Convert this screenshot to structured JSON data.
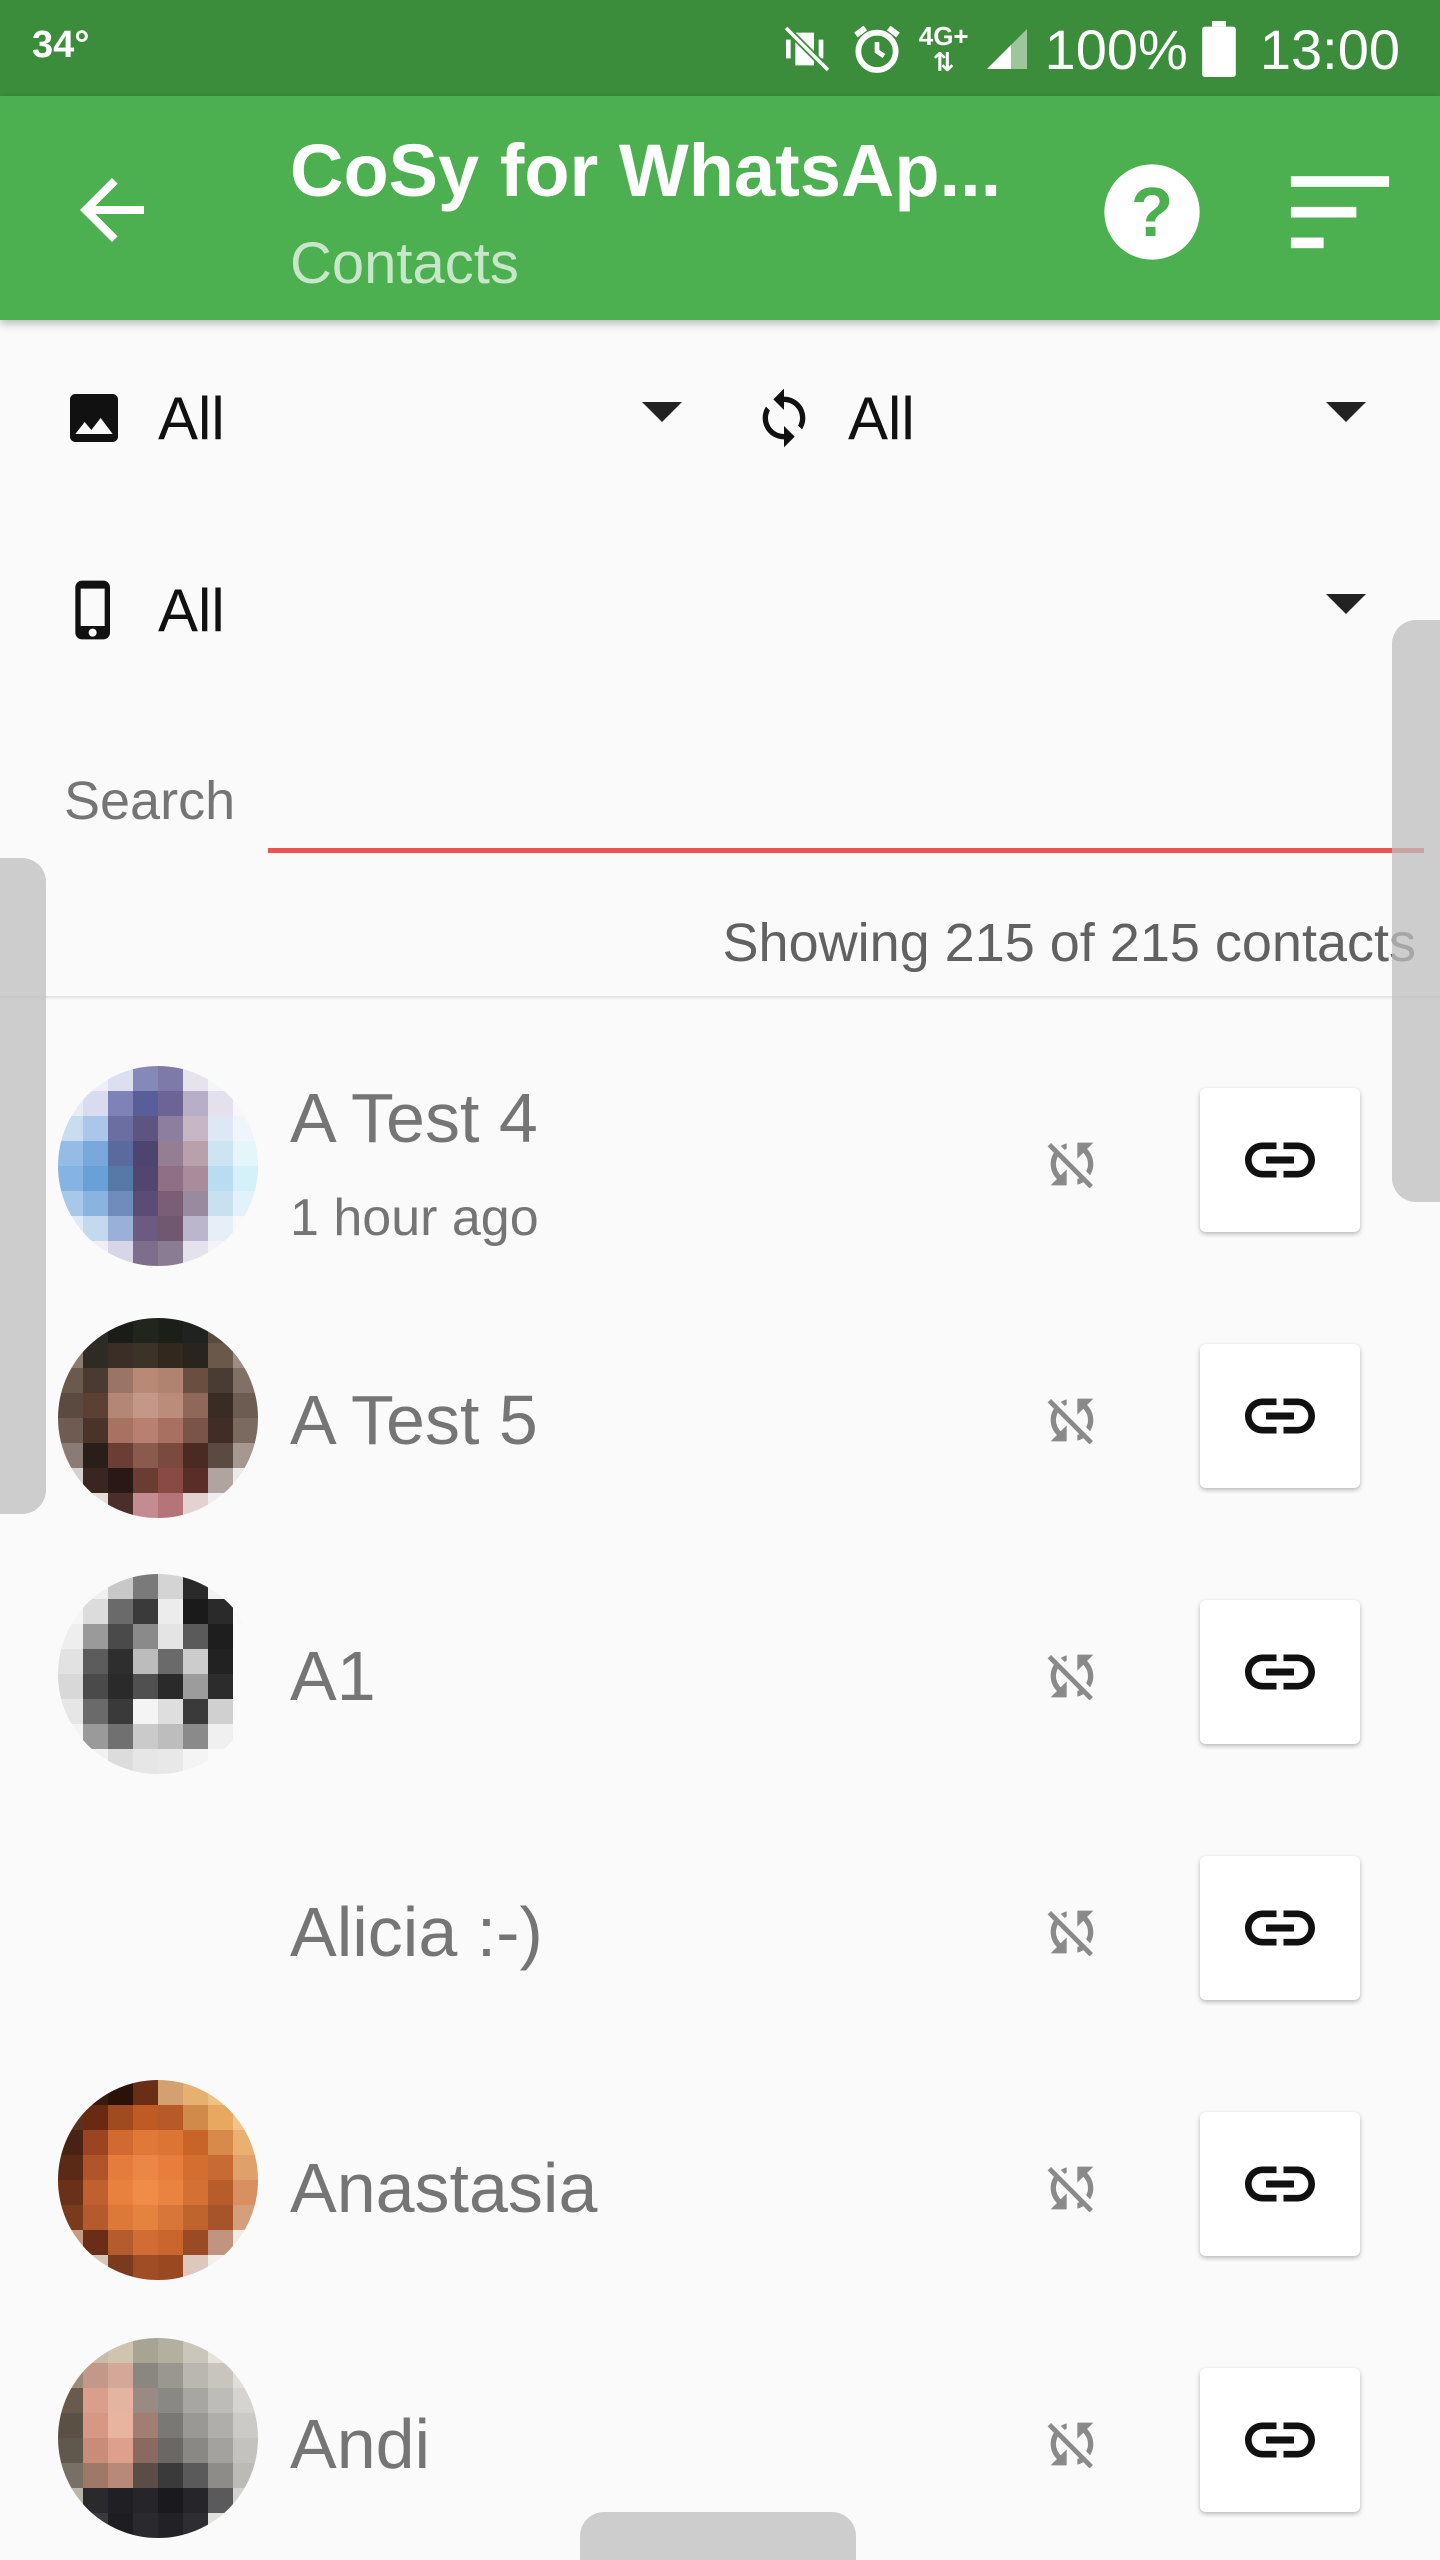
{
  "status_bar": {
    "temperature": "34°",
    "network": "4G+",
    "battery": "100%",
    "time": "13:00"
  },
  "app_bar": {
    "title": "CoSy for WhatsAp...",
    "subtitle": "Contacts"
  },
  "filters": {
    "photo": {
      "icon": "image-icon",
      "value": "All"
    },
    "sync": {
      "icon": "sync-icon",
      "value": "All"
    },
    "device": {
      "icon": "phone-icon",
      "value": "All"
    }
  },
  "search": {
    "placeholder": "Search",
    "value": ""
  },
  "summary": "Showing 215 of 215 contacts",
  "contacts": [
    {
      "name": "A Test 4",
      "subtitle": "1 hour ago",
      "has_avatar": true
    },
    {
      "name": "A Test 5",
      "subtitle": "",
      "has_avatar": true
    },
    {
      "name": "A1",
      "subtitle": "",
      "has_avatar": true
    },
    {
      "name": "Alicia :-)",
      "subtitle": "",
      "has_avatar": false
    },
    {
      "name": "Anastasia",
      "subtitle": "",
      "has_avatar": true
    },
    {
      "name": "Andi",
      "subtitle": "",
      "has_avatar": true
    }
  ],
  "colors": {
    "status_bar": "#3b8c3b",
    "app_bar": "#4caf50",
    "accent_underline": "#ef5350",
    "contact_text": "#757575"
  }
}
